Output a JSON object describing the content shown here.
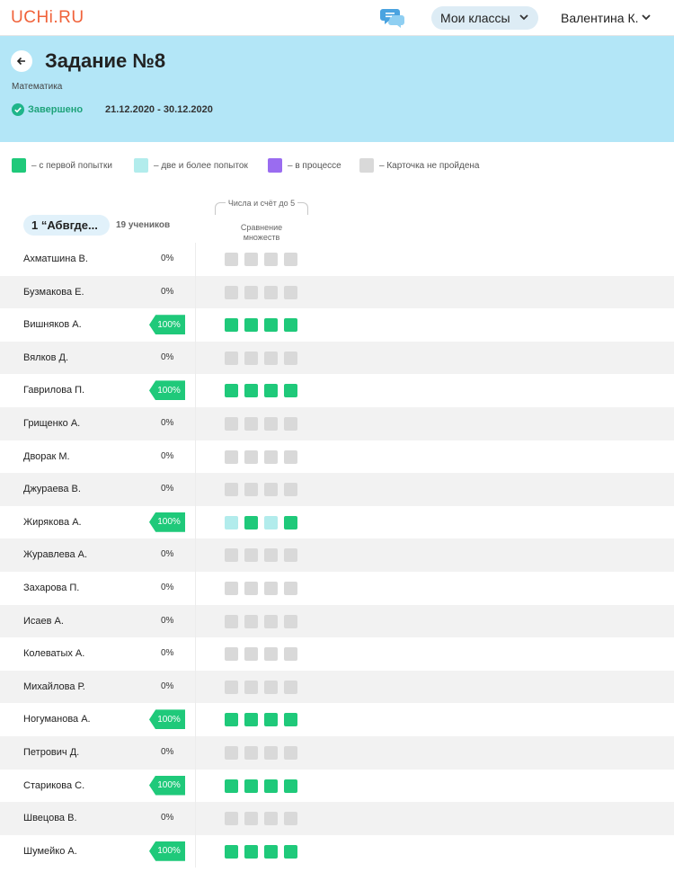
{
  "header": {
    "logo": "UCHi.RU",
    "classes_label": "Мои классы",
    "user_label": "Валентина К."
  },
  "task": {
    "title": "Задание №8",
    "subject": "Математика",
    "status": "Завершено",
    "dates": "21.12.2020 - 30.12.2020"
  },
  "legend": [
    {
      "label": "– с первой попытки",
      "color": "#1fc97a"
    },
    {
      "label": "– две и более попыток",
      "color": "#b2ecec"
    },
    {
      "label": "– в процессе",
      "color": "#9a6cf0"
    },
    {
      "label": "– Карточка не пройдена",
      "color": "#d9d9d9"
    }
  ],
  "table": {
    "class_name": "1 “Абвгде...",
    "students_count": "19 учеников",
    "topic": "Числа и счёт до 5",
    "card_title_line1": "Сравнение",
    "card_title_line2": "множеств"
  },
  "colors": {
    "first": "#1fc97a",
    "multi": "#b2ecec",
    "progress": "#9a6cf0",
    "none": "#d9d9d9"
  },
  "students": [
    {
      "name": "Ахматшина В.",
      "percent": "0%",
      "cells": [
        "none",
        "none",
        "none",
        "none"
      ]
    },
    {
      "name": "Бузмакова Е.",
      "percent": "0%",
      "cells": [
        "none",
        "none",
        "none",
        "none"
      ]
    },
    {
      "name": "Вишняков А.",
      "percent": "100%",
      "cells": [
        "first",
        "first",
        "first",
        "first"
      ]
    },
    {
      "name": "Вялков Д.",
      "percent": "0%",
      "cells": [
        "none",
        "none",
        "none",
        "none"
      ]
    },
    {
      "name": "Гаврилова П.",
      "percent": "100%",
      "cells": [
        "first",
        "first",
        "first",
        "first"
      ]
    },
    {
      "name": "Грищенко А.",
      "percent": "0%",
      "cells": [
        "none",
        "none",
        "none",
        "none"
      ]
    },
    {
      "name": "Дворак М.",
      "percent": "0%",
      "cells": [
        "none",
        "none",
        "none",
        "none"
      ]
    },
    {
      "name": "Джураева В.",
      "percent": "0%",
      "cells": [
        "none",
        "none",
        "none",
        "none"
      ]
    },
    {
      "name": "Жирякова А.",
      "percent": "100%",
      "cells": [
        "multi",
        "first",
        "multi",
        "first"
      ]
    },
    {
      "name": "Журавлева А.",
      "percent": "0%",
      "cells": [
        "none",
        "none",
        "none",
        "none"
      ]
    },
    {
      "name": "Захарова П.",
      "percent": "0%",
      "cells": [
        "none",
        "none",
        "none",
        "none"
      ]
    },
    {
      "name": "Исаев А.",
      "percent": "0%",
      "cells": [
        "none",
        "none",
        "none",
        "none"
      ]
    },
    {
      "name": "Колеватых А.",
      "percent": "0%",
      "cells": [
        "none",
        "none",
        "none",
        "none"
      ]
    },
    {
      "name": "Михайлова Р.",
      "percent": "0%",
      "cells": [
        "none",
        "none",
        "none",
        "none"
      ]
    },
    {
      "name": "Ногуманова А.",
      "percent": "100%",
      "cells": [
        "first",
        "first",
        "first",
        "first"
      ]
    },
    {
      "name": "Петрович Д.",
      "percent": "0%",
      "cells": [
        "none",
        "none",
        "none",
        "none"
      ]
    },
    {
      "name": "Старикова С.",
      "percent": "100%",
      "cells": [
        "first",
        "first",
        "first",
        "first"
      ]
    },
    {
      "name": "Швецова В.",
      "percent": "0%",
      "cells": [
        "none",
        "none",
        "none",
        "none"
      ]
    },
    {
      "name": "Шумейко А.",
      "percent": "100%",
      "cells": [
        "first",
        "first",
        "first",
        "first"
      ]
    }
  ]
}
